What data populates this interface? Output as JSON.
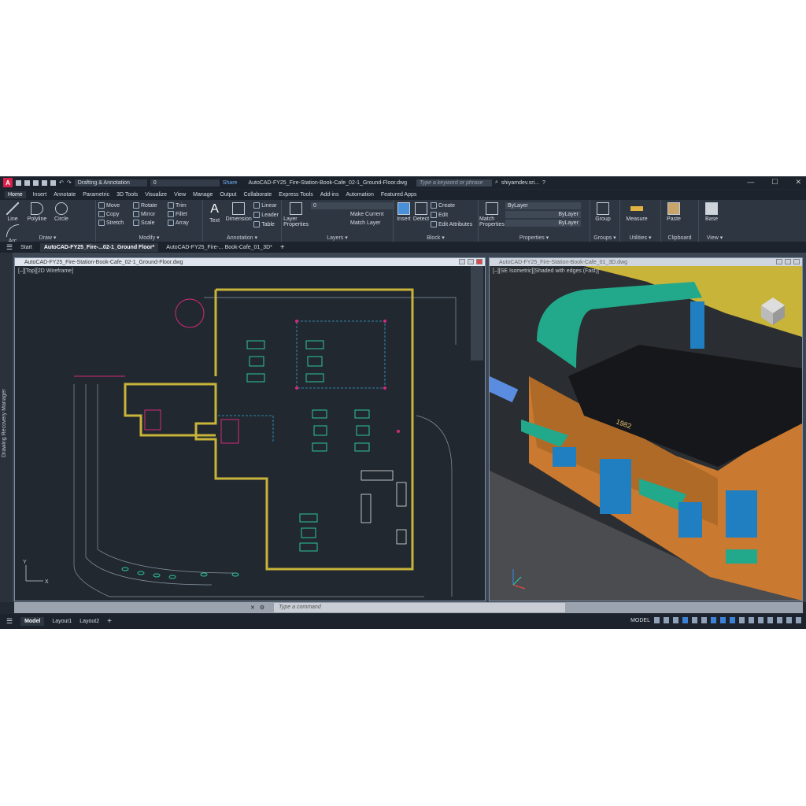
{
  "titlebar": {
    "workspace": "Drafting & Annotation",
    "layer": "0",
    "share": "Share",
    "title": "AutoCAD-FY25_Fire-Station-Book-Cafe_02-1_Ground-Floor.dwg",
    "search_placeholder": "Type a keyword or phrase",
    "user": "shiyamdev.sri...",
    "minimize": "—",
    "maximize": "☐",
    "close": "✕"
  },
  "ribbon_tabs": [
    "Home",
    "Insert",
    "Annotate",
    "Parametric",
    "3D Tools",
    "Visualize",
    "View",
    "Manage",
    "Output",
    "Collaborate",
    "Express Tools",
    "Add-ins",
    "Automation",
    "Featured Apps"
  ],
  "panels": {
    "draw": {
      "title": "Draw ▾",
      "tools": [
        "Line",
        "Polyline",
        "Circle",
        "Arc"
      ]
    },
    "modify": {
      "title": "Modify ▾",
      "tools": [
        "Move",
        "Rotate",
        "Trim",
        "Copy",
        "Mirror",
        "Fillet",
        "Stretch",
        "Scale",
        "Array"
      ]
    },
    "annotation": {
      "title": "Annotation ▾",
      "tools": [
        "Text",
        "Dimension",
        "Linear",
        "Leader",
        "Table"
      ]
    },
    "layers": {
      "title": "Layers ▾",
      "big": "Layer Properties",
      "layer": "0",
      "tools": [
        "Make Current",
        "Match Layer"
      ]
    },
    "block": {
      "title": "Block ▾",
      "big": [
        "Insert",
        "Detect"
      ],
      "tools": [
        "Create",
        "Edit",
        "Edit Attributes"
      ]
    },
    "properties": {
      "title": "Properties ▾",
      "big": "Match Properties",
      "color": "ByLayer",
      "linetype": "ByLayer",
      "lineweight": "ByLayer"
    },
    "groups": {
      "title": "Groups ▾",
      "big": "Group"
    },
    "utilities": {
      "title": "Utilities ▾",
      "big": "Measure"
    },
    "clipboard": {
      "title": "Clipboard",
      "big": "Paste"
    },
    "view": {
      "title": "View ▾",
      "big": "Base"
    }
  },
  "doc_tabs": {
    "start": "Start",
    "tabs": [
      "AutoCAD-FY25_Fire-...02-1_Ground Floor*",
      "AutoCAD-FY25_Fire-... Book-Cafe_01_3D*"
    ],
    "add": "+"
  },
  "recovery": "Drawing Recovery Manager",
  "viewports": [
    {
      "title": "AutoCAD-FY25_Fire-Station-Book-Cafe_02-1_Ground-Floor.dwg",
      "label": "[–][Top][2D Wireframe]"
    },
    {
      "title": "AutoCAD-FY25_Fire-Station-Book-Cafe_01_3D.dwg",
      "label": "[–][SE Isometric][Shaded with edges (Fast)]",
      "year": "1982"
    }
  ],
  "command": {
    "placeholder": "Type a command"
  },
  "status": {
    "tabs": [
      "Model",
      "Layout1",
      "Layout2"
    ],
    "add": "+",
    "model": "MODEL"
  },
  "colors": {
    "accent": "#3b82d6",
    "wall": "#e8d44d",
    "furniture": "#2ec4a0",
    "roof": "#22a88a",
    "brick": "#c97a30"
  }
}
